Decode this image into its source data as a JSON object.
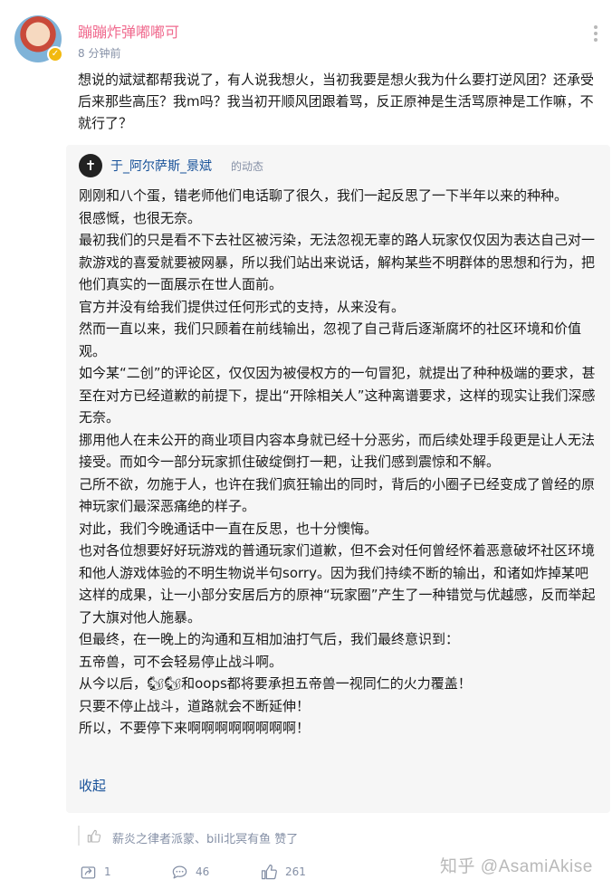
{
  "comment": {
    "username": "蹦蹦炸弹嘟嘟可",
    "time": "8 分钟前",
    "text": "想说的斌斌都帮我说了，有人说我想火，当初我要是想火我为什么要打逆风团？还承受后来那些高压？我m吗？我当初开顺风团跟着骂，反正原神是生活骂原神是工作嘛，不就行了？"
  },
  "quote": {
    "author": "于_阿尔萨斯_景斌",
    "suffix": "的动态",
    "paragraphs": [
      "刚刚和八个蛋，错老师他们电话聊了很久，我们一起反思了一下半年以来的种种。",
      "很感慨，也很无奈。",
      "最初我们的只是看不下去社区被污染，无法忽视无辜的路人玩家仅仅因为表达自己对一款游戏的喜爱就要被网暴，所以我们站出来说话，解构某些不明群体的思想和行为，把他们真实的一面展示在世人面前。",
      "官方并没有给我们提供过任何形式的支持，从来没有。",
      "然而一直以来，我们只顾着在前线输出，忽视了自己背后逐渐腐坏的社区环境和价值观。",
      "如今某“二创”的评论区，仅仅因为被侵权方的一句冒犯，就提出了种种极端的要求，甚至在对方已经道歉的前提下，提出“开除相关人”这种离谱要求，这样的现实让我们深感无奈。",
      "挪用他人在未公开的商业项目内容本身就已经十分恶劣，而后续处理手段更是让人无法接受。而如今一部分玩家抓住破绽倒打一耙，让我们感到震惊和不解。",
      "己所不欲，勿施于人，也许在我们疯狂输出的同时，背后的小圈子已经变成了曾经的原神玩家们最深恶痛绝的样子。",
      "对此，我们今晚通话中一直在反思，也十分懊悔。",
      "也对各位想要好好玩游戏的普通玩家们道歉，但不会对任何曾经怀着恶意破坏社区环境和他人游戏体验的不明生物说半句sorry。因为我们持续不断的输出，和诸如炸掉某吧这样的成果，让一小部分安居后方的原神“玩家圈”产生了一种错觉与优越感，反而举起了大旗对他人施暴。",
      "但最终，在一晚上的沟通和互相加油打气后，我们最终意识到：",
      "五帝兽，可不会轻易停止战斗啊。",
      "从今以后，🐿🐿和oops都将要承担五帝兽一视同仁的火力覆盖！",
      "只要不停止战斗，道路就会不断延伸！",
      "所以，不要停下来啊啊啊啊啊啊啊啊！"
    ],
    "collapse_label": "收起"
  },
  "likes": {
    "text": "薪炎之律者派蒙、bili北冥有鱼 赞了"
  },
  "actions": {
    "repost_count": "1",
    "comment_count": "46",
    "like_count": "261"
  },
  "watermark": "知乎 @AsamiAkise",
  "colors": {
    "username": "#f06b8f",
    "link": "#175199",
    "meta": "#8590a6",
    "quote_bg": "#f6f6f6"
  }
}
